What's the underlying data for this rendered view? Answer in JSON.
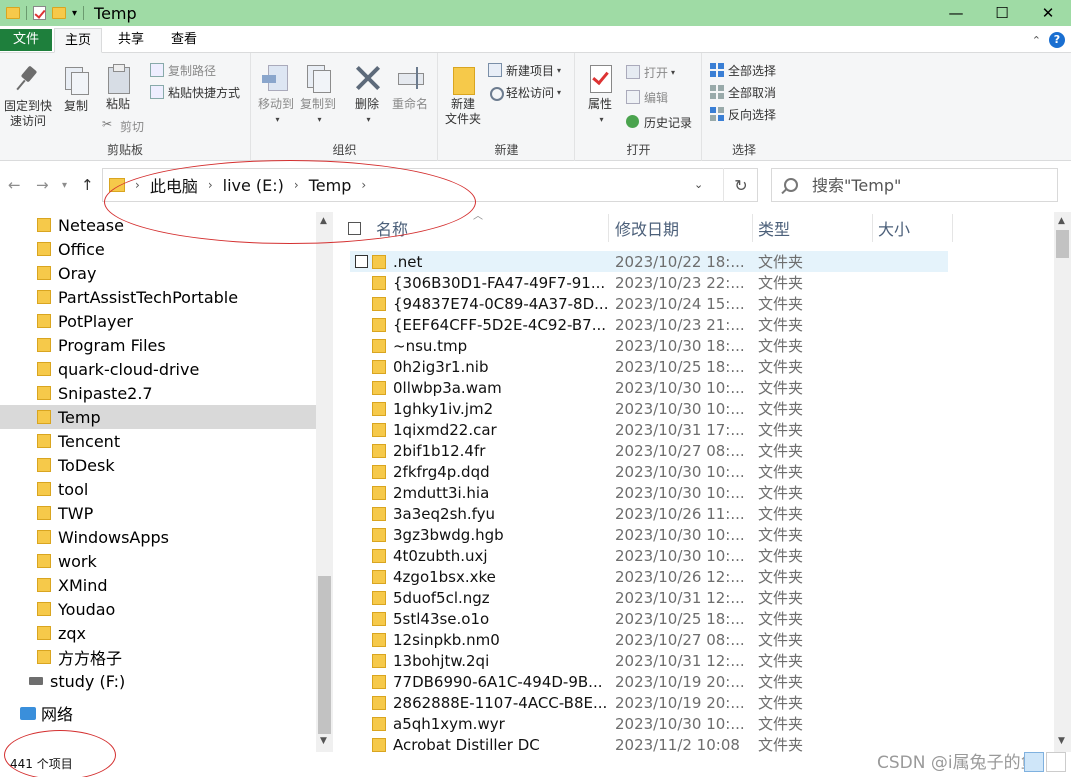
{
  "window": {
    "title": "Temp",
    "controls": {
      "minimize": "—",
      "maximize": "☐",
      "close": "✕"
    }
  },
  "ribbon_tabs": {
    "file": "文件",
    "home": "主页",
    "share": "共享",
    "view": "查看"
  },
  "ribbon": {
    "clipboard": {
      "label": "剪贴板",
      "pin": "固定到快\n速访问",
      "pin_line1": "固定到快",
      "pin_line2": "速访问",
      "copy": "复制",
      "paste": "粘贴",
      "copy_path": "复制路径",
      "paste_shortcut": "粘贴快捷方式",
      "cut": "剪切"
    },
    "organize": {
      "label": "组织",
      "move_to": "移动到",
      "copy_to": "复制到",
      "delete": "删除",
      "rename": "重命名"
    },
    "new": {
      "label": "新建",
      "new_folder_line1": "新建",
      "new_folder_line2": "文件夹",
      "new_item": "新建项目",
      "easy_access": "轻松访问"
    },
    "open": {
      "label": "打开",
      "properties": "属性",
      "open": "打开",
      "edit": "编辑",
      "history": "历史记录"
    },
    "select": {
      "label": "选择",
      "select_all": "全部选择",
      "select_none": "全部取消",
      "invert": "反向选择"
    }
  },
  "address": {
    "crumbs": [
      "此电脑",
      "live (E:)",
      "Temp"
    ],
    "search_placeholder": "搜索\"Temp\""
  },
  "nav_pane": {
    "folders": [
      "Netease",
      "Office",
      "Oray",
      "PartAssistTechPortable",
      "PotPlayer",
      "Program Files",
      "quark-cloud-drive",
      "Snipaste2.7",
      "Temp",
      "Tencent",
      "ToDesk",
      "tool",
      "TWP",
      "WindowsApps",
      "work",
      "XMind",
      "Youdao",
      "zqx",
      "方方格子"
    ],
    "selected": "Temp",
    "drive": "study (F:)",
    "network": "网络"
  },
  "columns": {
    "name": "名称",
    "modified": "修改日期",
    "type": "类型",
    "size": "大小"
  },
  "files": [
    {
      "name": ".net",
      "date": "2023/10/22 18:...",
      "type": "文件夹"
    },
    {
      "name": "{306B30D1-FA47-49F7-91...",
      "date": "2023/10/23 22:...",
      "type": "文件夹"
    },
    {
      "name": "{94837E74-0C89-4A37-8D...",
      "date": "2023/10/24 15:...",
      "type": "文件夹"
    },
    {
      "name": "{EEF64CFF-5D2E-4C92-B7...",
      "date": "2023/10/23 21:...",
      "type": "文件夹"
    },
    {
      "name": "~nsu.tmp",
      "date": "2023/10/30 18:...",
      "type": "文件夹"
    },
    {
      "name": "0h2ig3r1.nib",
      "date": "2023/10/25 18:...",
      "type": "文件夹"
    },
    {
      "name": "0llwbp3a.wam",
      "date": "2023/10/30 10:...",
      "type": "文件夹"
    },
    {
      "name": "1ghky1iv.jm2",
      "date": "2023/10/30 10:...",
      "type": "文件夹"
    },
    {
      "name": "1qixmd22.car",
      "date": "2023/10/31 17:...",
      "type": "文件夹"
    },
    {
      "name": "2bif1b12.4fr",
      "date": "2023/10/27 08:...",
      "type": "文件夹"
    },
    {
      "name": "2fkfrg4p.dqd",
      "date": "2023/10/30 10:...",
      "type": "文件夹"
    },
    {
      "name": "2mdutt3i.hia",
      "date": "2023/10/30 10:...",
      "type": "文件夹"
    },
    {
      "name": "3a3eq2sh.fyu",
      "date": "2023/10/26 11:...",
      "type": "文件夹"
    },
    {
      "name": "3gz3bwdg.hgb",
      "date": "2023/10/30 10:...",
      "type": "文件夹"
    },
    {
      "name": "4t0zubth.uxj",
      "date": "2023/10/30 10:...",
      "type": "文件夹"
    },
    {
      "name": "4zgo1bsx.xke",
      "date": "2023/10/26 12:...",
      "type": "文件夹"
    },
    {
      "name": "5duof5cl.ngz",
      "date": "2023/10/31 12:...",
      "type": "文件夹"
    },
    {
      "name": "5stl43se.o1o",
      "date": "2023/10/25 18:...",
      "type": "文件夹"
    },
    {
      "name": "12sinpkb.nm0",
      "date": "2023/10/27 08:...",
      "type": "文件夹"
    },
    {
      "name": "13bohjtw.2qi",
      "date": "2023/10/31 12:...",
      "type": "文件夹"
    },
    {
      "name": "77DB6990-6A1C-494D-9B...",
      "date": "2023/10/19 20:...",
      "type": "文件夹"
    },
    {
      "name": "2862888E-1107-4ACC-B8E...",
      "date": "2023/10/19 20:...",
      "type": "文件夹"
    },
    {
      "name": "a5qh1xym.wyr",
      "date": "2023/10/30 10:...",
      "type": "文件夹"
    },
    {
      "name": "Acrobat Distiller DC",
      "date": "2023/11/2 10:08",
      "type": "文件夹"
    }
  ],
  "status": {
    "count": "441 个项目"
  },
  "watermark": "CSDN @i属兔子的鱼",
  "colors": {
    "titlebar": "#9fdba5",
    "file_tab": "#1e7f3c",
    "annotation": "#d43030",
    "folder": "#f6c94a"
  }
}
